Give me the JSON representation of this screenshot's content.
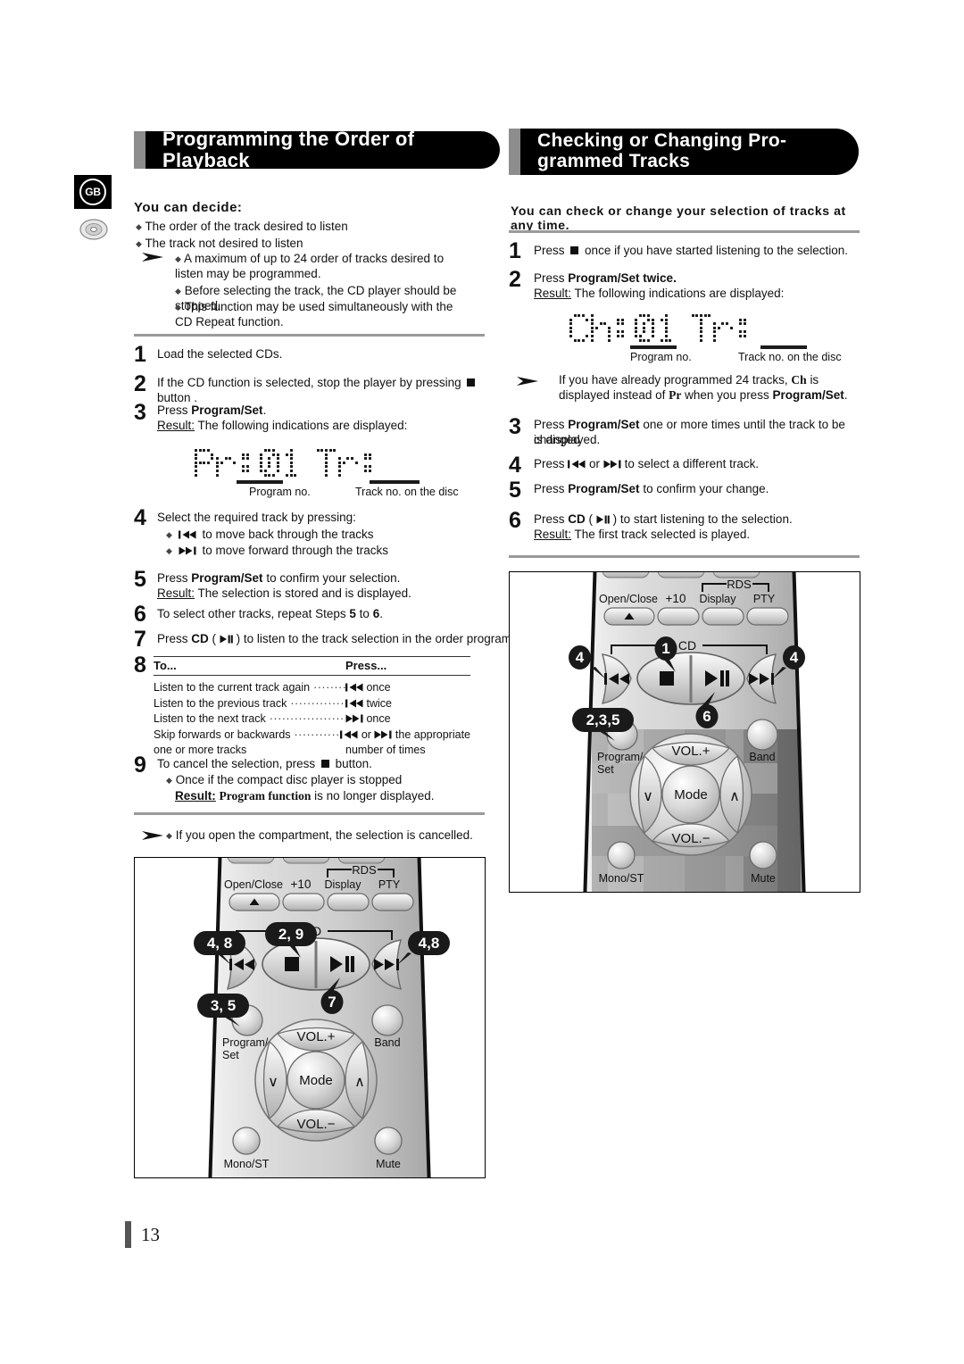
{
  "page": {
    "number": "13",
    "region_badge": "GB"
  },
  "left": {
    "banner_title": "Programming the Order of Playback",
    "heading": "You can decide:",
    "bullets": [
      "The order of the track desired to listen",
      "The track not desired to listen"
    ],
    "notes": [
      "A maximum of up to 24 order of tracks desired to listen may be programmed.",
      "Before selecting the track, the CD player should be stopped.",
      "This function may be used simultaneously with the CD Repeat function."
    ],
    "steps": {
      "s1_num": "1",
      "s1_text": "Load the selected CDs.",
      "s2_num": "2",
      "s2_a": "If the CD function is selected, stop the player by pressing",
      "s2_b": "button .",
      "s3_num": "3",
      "s3_a": "Press",
      "s3_bold": "Program/Set",
      "s3_period": ".",
      "s3_result_label": "Result:",
      "s3_result": "The following indications are displayed:",
      "s4_num": "4",
      "s4_text": "Select the required track by pressing:",
      "s4_b1": "to move back through the tracks",
      "s4_b2": "to move forward through the tracks",
      "s5_num": "5",
      "s5_a": "Press",
      "s5_bold": "Program/Set",
      "s5_b": "to confirm your selection.",
      "s5_result_label": "Result:",
      "s5_result": "The selection is stored and is displayed.",
      "s6_num": "6",
      "s6_a": "To select other tracks, repeat Steps",
      "s6_n1": "5",
      "s6_to": "to",
      "s6_n2": "6",
      "s6_end": ".",
      "s7_num": "7",
      "s7_a": "Press",
      "s7_bold": "CD",
      "s7_paren_open": "(",
      "s7_paren_close": ")",
      "s7_b": "to listen to the track selection in the order programmed.",
      "s8_num": "8",
      "s9_num": "9",
      "s9_a": "To cancel the selection, press",
      "s9_b": "button.",
      "s9_bullet": "Once if the compact disc player is stopped",
      "s9_result_label": "Result:",
      "s9_result_bold": "Program function",
      "s9_result_rest": "is no longer displayed."
    },
    "display": {
      "text": "Pr:01 Tr:",
      "label_program": "Program no.",
      "label_track": "Track no. on the disc"
    },
    "table": {
      "col1_header": "To...",
      "col2_header": "Press...",
      "rows": [
        {
          "action": "Listen to the current track again",
          "press_icon": "rew-icon",
          "press": "once"
        },
        {
          "action": "Listen to the previous track",
          "press_icon": "rew-icon",
          "press": "twice"
        },
        {
          "action": "Listen to the next track",
          "press_icon": "ff-icon",
          "press": "once"
        },
        {
          "action": "Skip forwards or backwards",
          "press_icon": "rew-ff-icon",
          "press": "the appropriate"
        }
      ],
      "row4_cont_action": "one or more tracks",
      "row4_cont_press": "number of times",
      "row4_or": "or"
    },
    "footnote": "If you open the compartment, the selection is cancelled."
  },
  "right": {
    "banner_title_line1": "Checking or Changing Pro-",
    "banner_title_line2": "grammed Tracks",
    "intro": "You can check or change your selection of tracks at any time.",
    "steps": {
      "s1_num": "1",
      "s1_a": "Press",
      "s1_b": "once if you have started listening to the selection.",
      "s2_num": "2",
      "s2_a": "Press",
      "s2_bold": "Program/Set twice.",
      "s2_result_label": "Result:",
      "s2_result": "The following indications are displayed:",
      "s3_num": "3",
      "s3_a": "Press",
      "s3_bold": "Program/Set",
      "s3_b": "one or more times until the track to be changed",
      "s3_c": "is displayed.",
      "s4_num": "4",
      "s4_a": "Press",
      "s4_or": "or",
      "s4_b": "to select a different track.",
      "s5_num": "5",
      "s5_a": "Press",
      "s5_bold": "Program/Set",
      "s5_b": "to confirm your change.",
      "s6_num": "6",
      "s6_a": "Press",
      "s6_bold": "CD",
      "s6_paren_open": "(",
      "s6_paren_close": ")",
      "s6_b": "to start listening to the selection.",
      "s6_result_label": "Result:",
      "s6_result": "The first track selected is played."
    },
    "display": {
      "text": "Ch:01 Tr:",
      "label_program": "Program no.",
      "label_track": "Track no. on the disc"
    },
    "note": {
      "part1": "If you have already programmed 24 tracks,",
      "ch": "Ch",
      "part2": "is displayed",
      "part3": "instead of",
      "pr": "Pr",
      "part4": "when you press",
      "bold": "Program/Set",
      "end": "."
    }
  },
  "remote_left": {
    "labels": {
      "open_close": "Open/Close",
      "plus10": "+10",
      "display": "Display",
      "pty": "PTY",
      "rds": "RDS",
      "cd": "CD",
      "program_set_1": "Program/",
      "program_set_2": "Set",
      "band": "Band",
      "vol_plus": "VOL.+",
      "vol_minus": "VOL.−",
      "mode": "Mode",
      "mono_st": "Mono/ST",
      "mute": "Mute",
      "down_chev": "∨",
      "up_chev": "∧"
    },
    "callouts": {
      "prev": "4, 8",
      "stop": "2, 9",
      "next": "4,8",
      "program": "3, 5",
      "play": "7"
    }
  },
  "remote_right": {
    "labels": {
      "open_close": "Open/Close",
      "plus10": "+10",
      "display": "Display",
      "pty": "PTY",
      "rds": "RDS",
      "cd": "CD",
      "program_set_1": "Program/",
      "program_set_2": "Set",
      "band": "Band",
      "vol_plus": "VOL.+",
      "vol_minus": "VOL.−",
      "mode": "Mode",
      "mono_st": "Mono/ST",
      "mute": "Mute",
      "down_chev": "∨",
      "up_chev": "∧"
    },
    "callouts": {
      "prev": "4",
      "stop": "1",
      "next": "4",
      "program": "2,3,5",
      "play": "6"
    }
  },
  "colors": {
    "banner_bg": "#000000",
    "banner_tab": "#8d8d8d",
    "rule": "#9a9a9a",
    "text": "#111111"
  }
}
